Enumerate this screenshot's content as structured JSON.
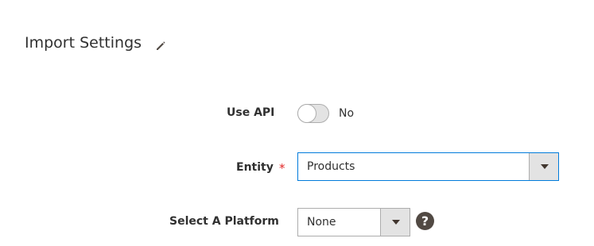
{
  "section": {
    "title": "Import Settings",
    "edit_icon": "pencil-icon"
  },
  "fields": {
    "use_api": {
      "label": "Use API",
      "value": "No",
      "enabled": false
    },
    "entity": {
      "label": "Entity",
      "required_marker": "*",
      "value": "Products"
    },
    "platform": {
      "label": "Select A Platform",
      "value": "None",
      "help_icon": "question-mark-icon",
      "help_glyph": "?"
    }
  },
  "colors": {
    "focus_border": "#007bdb",
    "required": "#e22626",
    "help_bg": "#514943",
    "text": "#303030"
  }
}
